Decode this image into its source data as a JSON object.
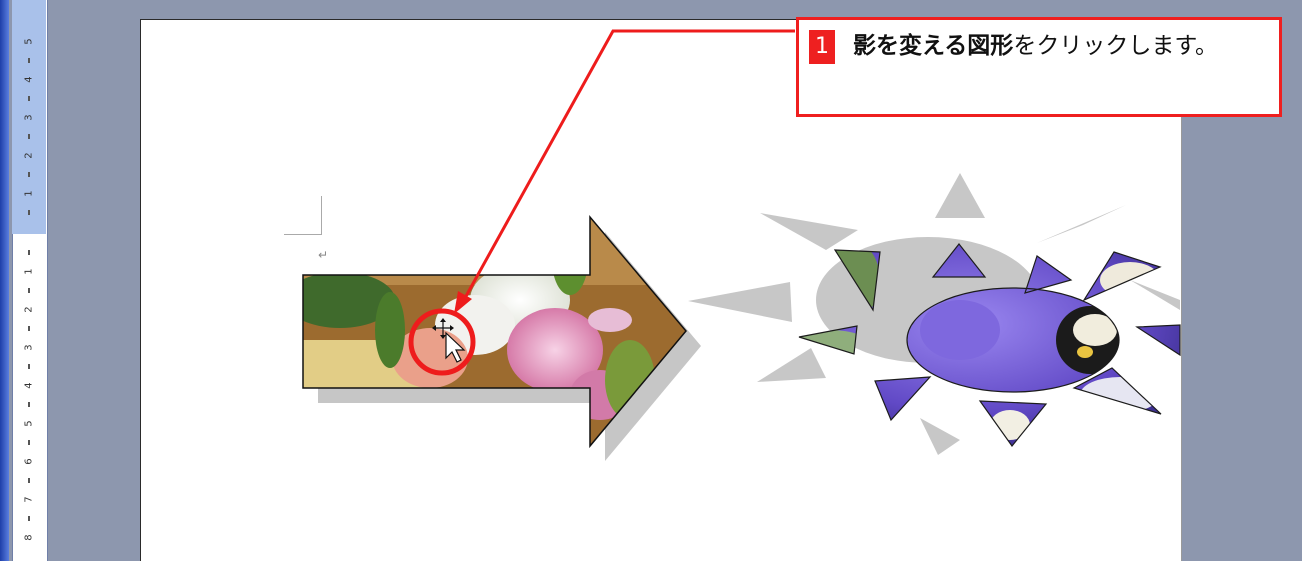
{
  "ruler": {
    "numbers_top": [
      "5",
      "4",
      "3",
      "2",
      "1"
    ],
    "numbers_bottom": [
      "1",
      "2",
      "3",
      "4",
      "5",
      "6",
      "7",
      "8"
    ]
  },
  "document": {
    "paragraph_mark": "↵"
  },
  "callout": {
    "step_number": "1",
    "bold_text": "影を変える図形",
    "text": "をクリックします。"
  },
  "colors": {
    "accent": "#ee2020",
    "page_background": "#8d97ae",
    "ruler_margin": "#a9c1ea",
    "shadow": "#c4c4c4",
    "pansy_purple": "#6d4fd0"
  },
  "shapes": {
    "arrow": "flower photo arrow",
    "sun": "pansy photo sun"
  }
}
